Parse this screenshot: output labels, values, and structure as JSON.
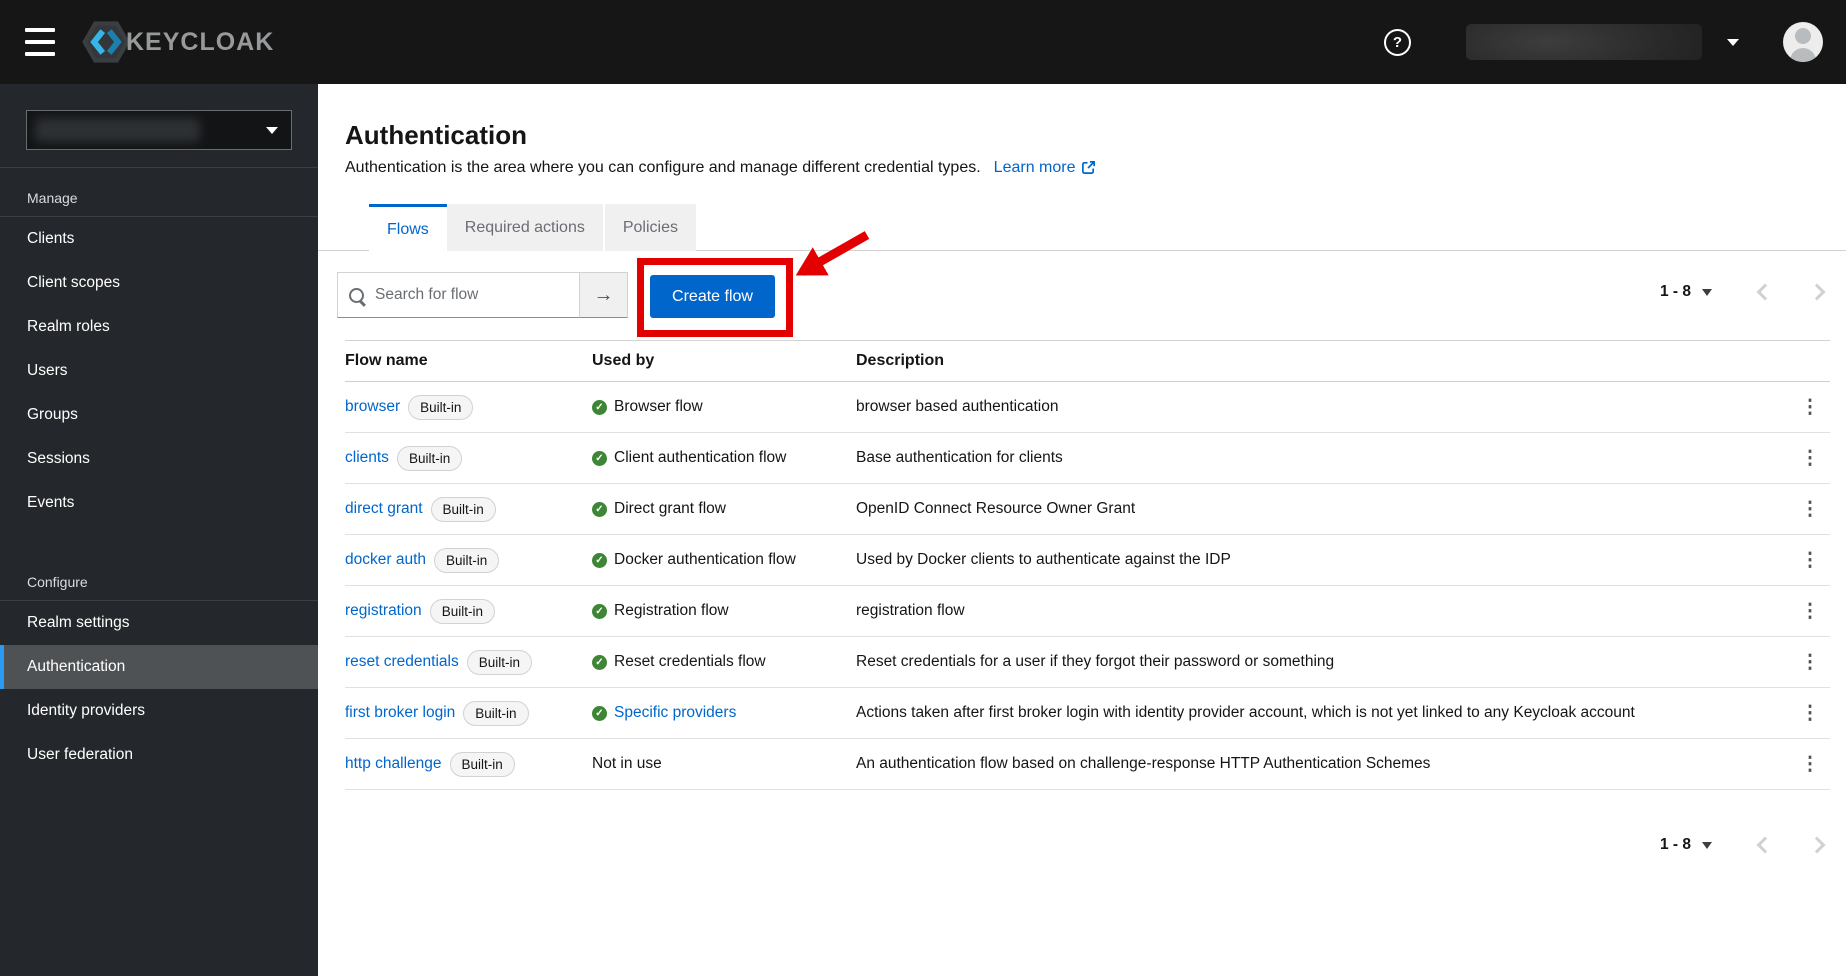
{
  "masthead": {
    "brand": "KEYCLOAK"
  },
  "icons": {
    "help": "?",
    "search_submit": "→",
    "check": "✓",
    "kebab": "⋮"
  },
  "sidebar": {
    "active_item": "Authentication",
    "sections": [
      {
        "label": "Manage",
        "items": [
          "Clients",
          "Client scopes",
          "Realm roles",
          "Users",
          "Groups",
          "Sessions",
          "Events"
        ]
      },
      {
        "label": "Configure",
        "items": [
          "Realm settings",
          "Authentication",
          "Identity providers",
          "User federation"
        ]
      }
    ]
  },
  "page": {
    "title": "Authentication",
    "description": "Authentication is the area where you can configure and manage different credential types.",
    "learn_more_label": "Learn more",
    "tabs": [
      "Flows",
      "Required actions",
      "Policies"
    ],
    "active_tab": "Flows"
  },
  "toolbar": {
    "search_placeholder": "Search for flow",
    "create_flow_label": "Create flow"
  },
  "pagination": {
    "range": "1 - 8"
  },
  "table": {
    "columns": [
      "Flow name",
      "Used by",
      "Description"
    ],
    "rows": [
      {
        "name": "browser",
        "badge": "Built-in",
        "used_by": "Browser flow",
        "check": true,
        "used_by_link": false,
        "description": "browser based authentication"
      },
      {
        "name": "clients",
        "badge": "Built-in",
        "used_by": "Client authentication flow",
        "check": true,
        "used_by_link": false,
        "description": "Base authentication for clients"
      },
      {
        "name": "direct grant",
        "badge": "Built-in",
        "used_by": "Direct grant flow",
        "check": true,
        "used_by_link": false,
        "description": "OpenID Connect Resource Owner Grant"
      },
      {
        "name": "docker auth",
        "badge": "Built-in",
        "used_by": "Docker authentication flow",
        "check": true,
        "used_by_link": false,
        "description": "Used by Docker clients to authenticate against the IDP"
      },
      {
        "name": "registration",
        "badge": "Built-in",
        "used_by": "Registration flow",
        "check": true,
        "used_by_link": false,
        "description": "registration flow"
      },
      {
        "name": "reset credentials",
        "badge": "Built-in",
        "used_by": "Reset credentials flow",
        "check": true,
        "used_by_link": false,
        "description": "Reset credentials for a user if they forgot their password or something"
      },
      {
        "name": "first broker login",
        "badge": "Built-in",
        "used_by": "Specific providers",
        "check": true,
        "used_by_link": true,
        "description": "Actions taken after first broker login with identity provider account, which is not yet linked to any Keycloak account"
      },
      {
        "name": "http challenge",
        "badge": "Built-in",
        "used_by": "Not in use",
        "check": false,
        "used_by_link": false,
        "description": "An authentication flow based on challenge-response HTTP Authentication Schemes"
      }
    ]
  },
  "colors": {
    "primary_blue": "#0066cc",
    "link_blue": "#0066cc",
    "success_green": "#3e8635",
    "annotation_red": "#e30000",
    "masthead_bg": "#161616",
    "sidebar_bg": "#24272b"
  }
}
